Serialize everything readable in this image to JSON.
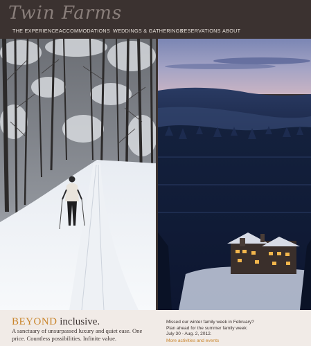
{
  "header": {
    "logo_text": "Twin Farms",
    "nav": [
      {
        "label": "THE EXPERIENCE"
      },
      {
        "label": "ACCOMMODATIONS"
      },
      {
        "label": "WEDDINGS & GATHERINGS"
      },
      {
        "label": "RESERVATIONS"
      },
      {
        "label": "ABOUT"
      }
    ]
  },
  "footer": {
    "tagline_accent": "BEYOND",
    "tagline_rest": " inclusive.",
    "tagline_body": "A sanctuary of unsurpassed luxury and quiet ease. One price. Countless possibilities. Infinite value.",
    "news_line1": "Missed our winter family week in February?",
    "news_line2": "Plan ahead for the summer family week:",
    "news_line3": "July 30 - Aug. 2, 2012.",
    "news_link": "More activities and events"
  },
  "colors": {
    "header_bg": "#3b3230",
    "footer_bg": "#f1ebe7",
    "accent": "#c9842a",
    "text_dark": "#3b3230"
  }
}
